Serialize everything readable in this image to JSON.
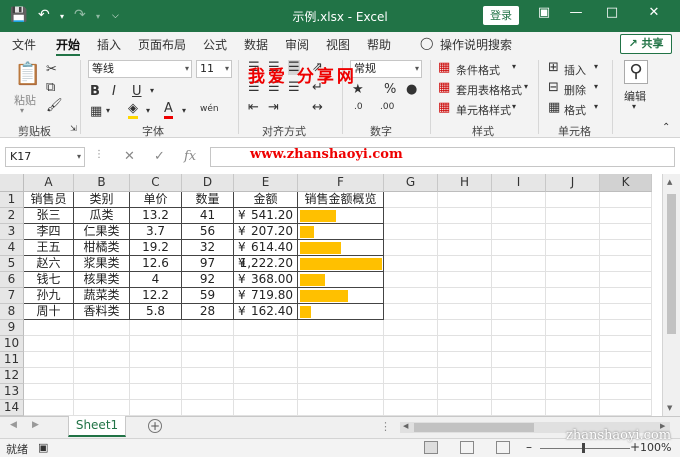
{
  "app": {
    "title": "示例.xlsx - Excel",
    "login_label": "登录"
  },
  "tabs": [
    {
      "label": "文件"
    },
    {
      "label": "开始"
    },
    {
      "label": "插入"
    },
    {
      "label": "页面布局"
    },
    {
      "label": "公式"
    },
    {
      "label": "数据"
    },
    {
      "label": "审阅"
    },
    {
      "label": "视图"
    },
    {
      "label": "帮助"
    },
    {
      "label": "操作说明搜索"
    }
  ],
  "share_label": "共享",
  "ribbon": {
    "paste_label": "粘贴",
    "clipboard_label": "剪贴板",
    "font_name": "等线",
    "font_size": "11",
    "font_label": "字体",
    "align_label": "对齐方式",
    "number_format": "常规",
    "number_label": "数字",
    "conditional_format": "条件格式",
    "table_format": "套用表格格式",
    "cell_style": "单元格样式",
    "styles_label": "样式",
    "insert_label": "插入",
    "delete_label": "删除",
    "format_label": "格式",
    "cells_label": "单元格",
    "edit_label": "编辑"
  },
  "watermark": {
    "text": "我爱 分享网",
    "url": "www.zhanshaoyi.com",
    "url_bottom": "zhanshaoyi.com"
  },
  "formula": {
    "name_box": "K17",
    "fx": "fx",
    "value": ""
  },
  "columns": [
    "A",
    "B",
    "C",
    "D",
    "E",
    "F",
    "G",
    "H",
    "I",
    "J",
    "K"
  ],
  "rows": [
    "1",
    "2",
    "3",
    "4",
    "5",
    "6",
    "7",
    "8",
    "9",
    "10",
    "11",
    "12",
    "13",
    "14"
  ],
  "table": {
    "headers": [
      "销售员",
      "类别",
      "单价",
      "数量",
      "金额",
      "销售金额概览"
    ],
    "currency": "¥",
    "rows": [
      {
        "name": "张三",
        "category": "瓜类",
        "price": "13.2",
        "qty": "41",
        "amount": "541.20",
        "bar": 541.2
      },
      {
        "name": "李四",
        "category": "仁果类",
        "price": "3.7",
        "qty": "56",
        "amount": "207.20",
        "bar": 207.2
      },
      {
        "name": "王五",
        "category": "柑橘类",
        "price": "19.2",
        "qty": "32",
        "amount": "614.40",
        "bar": 614.4
      },
      {
        "name": "赵六",
        "category": "浆果类",
        "price": "12.6",
        "qty": "97",
        "amount": "1,222.20",
        "bar": 1222.2
      },
      {
        "name": "钱七",
        "category": "核果类",
        "price": "4",
        "qty": "92",
        "amount": "368.00",
        "bar": 368.0
      },
      {
        "name": "孙九",
        "category": "蔬菜类",
        "price": "12.2",
        "qty": "59",
        "amount": "719.80",
        "bar": 719.8
      },
      {
        "name": "周十",
        "category": "香料类",
        "price": "5.8",
        "qty": "28",
        "amount": "162.40",
        "bar": 162.4
      }
    ],
    "bar_max": 1222.2,
    "bar_color": "#ffc000"
  },
  "sheet": {
    "name": "Sheet1"
  },
  "status": {
    "ready": "就绪",
    "zoom": "100%"
  }
}
